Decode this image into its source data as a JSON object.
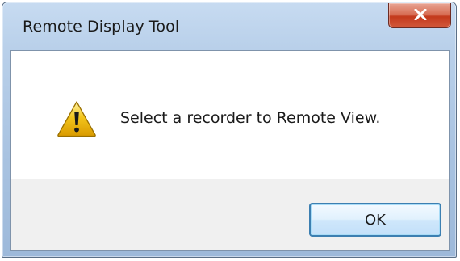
{
  "window": {
    "title": "Remote Display Tool",
    "close_icon": "close-icon"
  },
  "dialog": {
    "icon": "warning-icon",
    "message": "Select a recorder to Remote View.",
    "ok_label": "OK"
  },
  "colors": {
    "title_bar": "#b9d0ea",
    "close_button": "#c3391c",
    "button_border": "#3c7fb1",
    "warning_yellow": "#f3c51b",
    "text": "#1a1a1a"
  }
}
